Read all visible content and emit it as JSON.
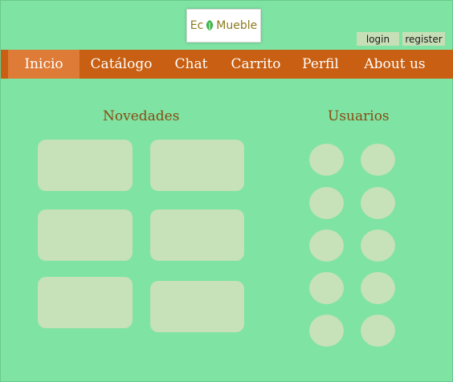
{
  "brand": {
    "prefix": "Ec",
    "suffix": "Mueble",
    "leaf_color": "#3cb54a"
  },
  "auth": {
    "login_label": "login",
    "register_label": "register"
  },
  "nav": {
    "items": [
      {
        "label": "Inicio",
        "active": true
      },
      {
        "label": "Catálogo"
      },
      {
        "label": "Chat"
      },
      {
        "label": "Carrito"
      },
      {
        "label": "Perfil"
      },
      {
        "label": "About us"
      }
    ]
  },
  "sections": {
    "novedades_title": "Novedades",
    "usuarios_title": "Usuarios"
  },
  "colors": {
    "background": "#7ee3a3",
    "navbar": "#c85f12",
    "active_tab": "#de7b37",
    "placeholder": "#c7e1b8",
    "title_text": "#8a4a12"
  }
}
